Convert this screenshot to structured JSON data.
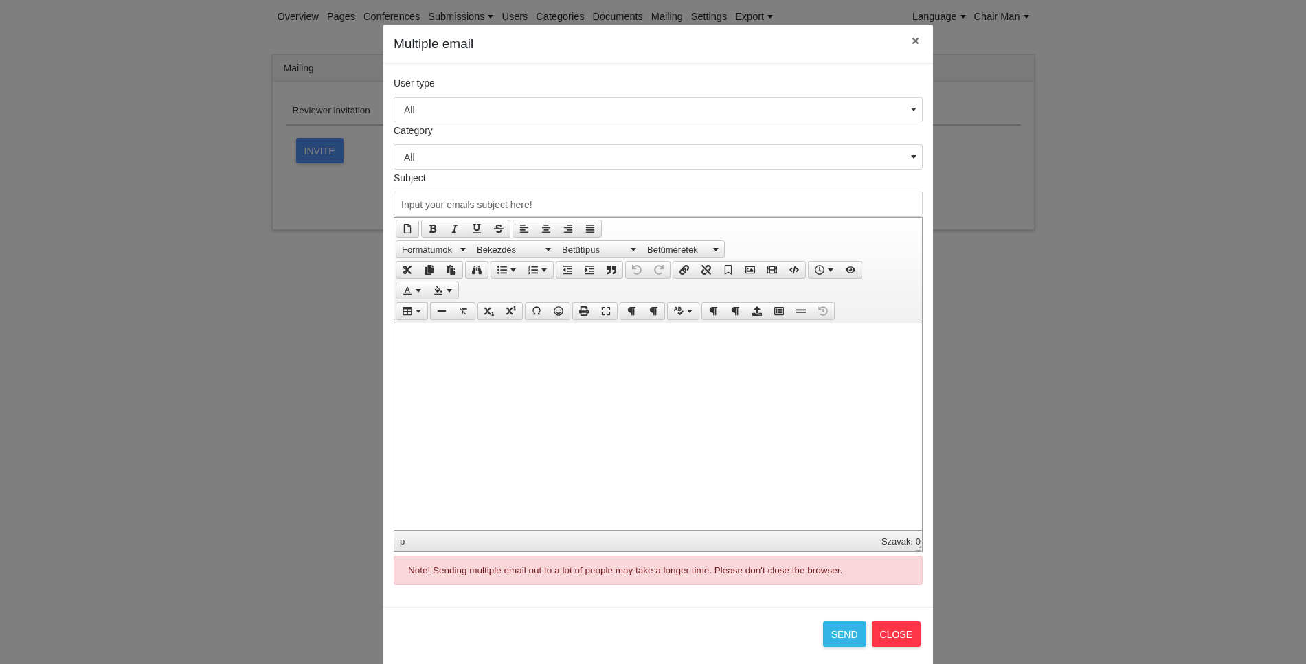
{
  "nav": {
    "left": [
      {
        "label": "Overview",
        "caret": false
      },
      {
        "label": "Pages",
        "caret": false
      },
      {
        "label": "Conferences",
        "caret": false
      },
      {
        "label": "Submissions",
        "caret": true
      },
      {
        "label": "Users",
        "caret": false
      },
      {
        "label": "Categories",
        "caret": false
      },
      {
        "label": "Documents",
        "caret": false
      },
      {
        "label": "Mailing",
        "caret": false
      },
      {
        "label": "Settings",
        "caret": false
      },
      {
        "label": "Export",
        "caret": true
      }
    ],
    "right": [
      {
        "label": "Language",
        "caret": true
      },
      {
        "label": "Chair Man",
        "caret": true
      }
    ]
  },
  "panel": {
    "title": "Mailing",
    "tab": "Reviewer invitation",
    "invite_button": "INVITE"
  },
  "modal": {
    "title": "Multiple email",
    "fields": [
      {
        "kind": "select",
        "label": "User type",
        "value": "All"
      },
      {
        "kind": "select",
        "label": "Category",
        "value": "All"
      },
      {
        "kind": "text",
        "label": "Subject",
        "placeholder": "Input your emails subject here!"
      }
    ],
    "editor": {
      "toolbar": [
        [
          {
            "kind": "icons",
            "buttons": [
              {
                "caret": false,
                "disabled": false
              }
            ]
          },
          {
            "kind": "icons",
            "buttons": [
              {
                "caret": false,
                "disabled": false
              },
              {
                "caret": false,
                "disabled": false
              },
              {
                "caret": false,
                "disabled": false
              },
              {
                "caret": false,
                "disabled": false
              }
            ]
          },
          {
            "kind": "icons",
            "buttons": [
              {
                "caret": false,
                "disabled": false
              },
              {
                "caret": false,
                "disabled": false
              },
              {
                "caret": false,
                "disabled": false
              },
              {
                "caret": false,
                "disabled": false
              }
            ]
          }
        ],
        [
          {
            "kind": "menus",
            "menus": [
              "Formátumok",
              "Bekezdés",
              "Betűtípus",
              "Betűméretek"
            ]
          }
        ],
        [
          {
            "kind": "icons",
            "buttons": [
              {
                "caret": false,
                "disabled": false
              },
              {
                "caret": false,
                "disabled": false
              },
              {
                "caret": false,
                "disabled": false
              }
            ]
          },
          {
            "kind": "icons",
            "buttons": [
              {
                "caret": false,
                "disabled": false
              }
            ]
          },
          {
            "kind": "icons",
            "buttons": [
              {
                "caret": true,
                "disabled": false
              },
              {
                "caret": true,
                "disabled": false
              }
            ]
          },
          {
            "kind": "icons",
            "buttons": [
              {
                "caret": false,
                "disabled": false
              },
              {
                "caret": false,
                "disabled": false
              },
              {
                "caret": false,
                "disabled": false
              }
            ]
          },
          {
            "kind": "icons",
            "buttons": [
              {
                "caret": false,
                "disabled": true
              },
              {
                "caret": false,
                "disabled": true
              }
            ]
          },
          {
            "kind": "icons",
            "buttons": [
              {
                "caret": false,
                "disabled": false
              },
              {
                "caret": false,
                "disabled": false
              },
              {
                "caret": false,
                "disabled": false
              },
              {
                "caret": false,
                "disabled": false
              },
              {
                "caret": false,
                "disabled": false
              },
              {
                "caret": false,
                "disabled": false
              }
            ]
          },
          {
            "kind": "icons",
            "buttons": [
              {
                "caret": true,
                "disabled": false
              },
              {
                "caret": false,
                "disabled": false
              }
            ]
          }
        ],
        [
          {
            "kind": "icons",
            "buttons": [
              {
                "caret": true,
                "disabled": false
              },
              {
                "caret": true,
                "disabled": false
              }
            ]
          }
        ],
        [
          {
            "kind": "icons",
            "buttons": [
              {
                "caret": true,
                "disabled": false
              }
            ]
          },
          {
            "kind": "icons",
            "buttons": [
              {
                "caret": false,
                "disabled": false
              },
              {
                "caret": false,
                "disabled": false
              }
            ]
          },
          {
            "kind": "icons",
            "buttons": [
              {
                "caret": false,
                "disabled": false
              },
              {
                "caret": false,
                "disabled": false
              }
            ]
          },
          {
            "kind": "icons",
            "buttons": [
              {
                "caret": false,
                "disabled": false
              },
              {
                "caret": false,
                "disabled": false
              }
            ]
          },
          {
            "kind": "icons",
            "buttons": [
              {
                "caret": false,
                "disabled": false
              },
              {
                "caret": false,
                "disabled": false
              }
            ]
          },
          {
            "kind": "icons",
            "buttons": [
              {
                "caret": false,
                "disabled": false
              },
              {
                "caret": false,
                "disabled": false
              }
            ]
          },
          {
            "kind": "icons",
            "buttons": [
              {
                "caret": true,
                "disabled": false
              }
            ]
          },
          {
            "kind": "icons",
            "buttons": [
              {
                "caret": false,
                "disabled": false
              },
              {
                "caret": false,
                "disabled": false
              },
              {
                "caret": false,
                "disabled": false
              },
              {
                "caret": false,
                "disabled": false
              },
              {
                "caret": false,
                "disabled": false
              },
              {
                "caret": false,
                "disabled": true
              }
            ]
          }
        ]
      ],
      "path": "p",
      "word_count": "Szavak: 0"
    },
    "alert": "Note! Sending multiple email out to a lot of people may take a longer time. Please don't close the browser.",
    "buttons": [
      {
        "kind": "send",
        "label": "SEND"
      },
      {
        "kind": "close",
        "label": "CLOSE"
      }
    ]
  }
}
